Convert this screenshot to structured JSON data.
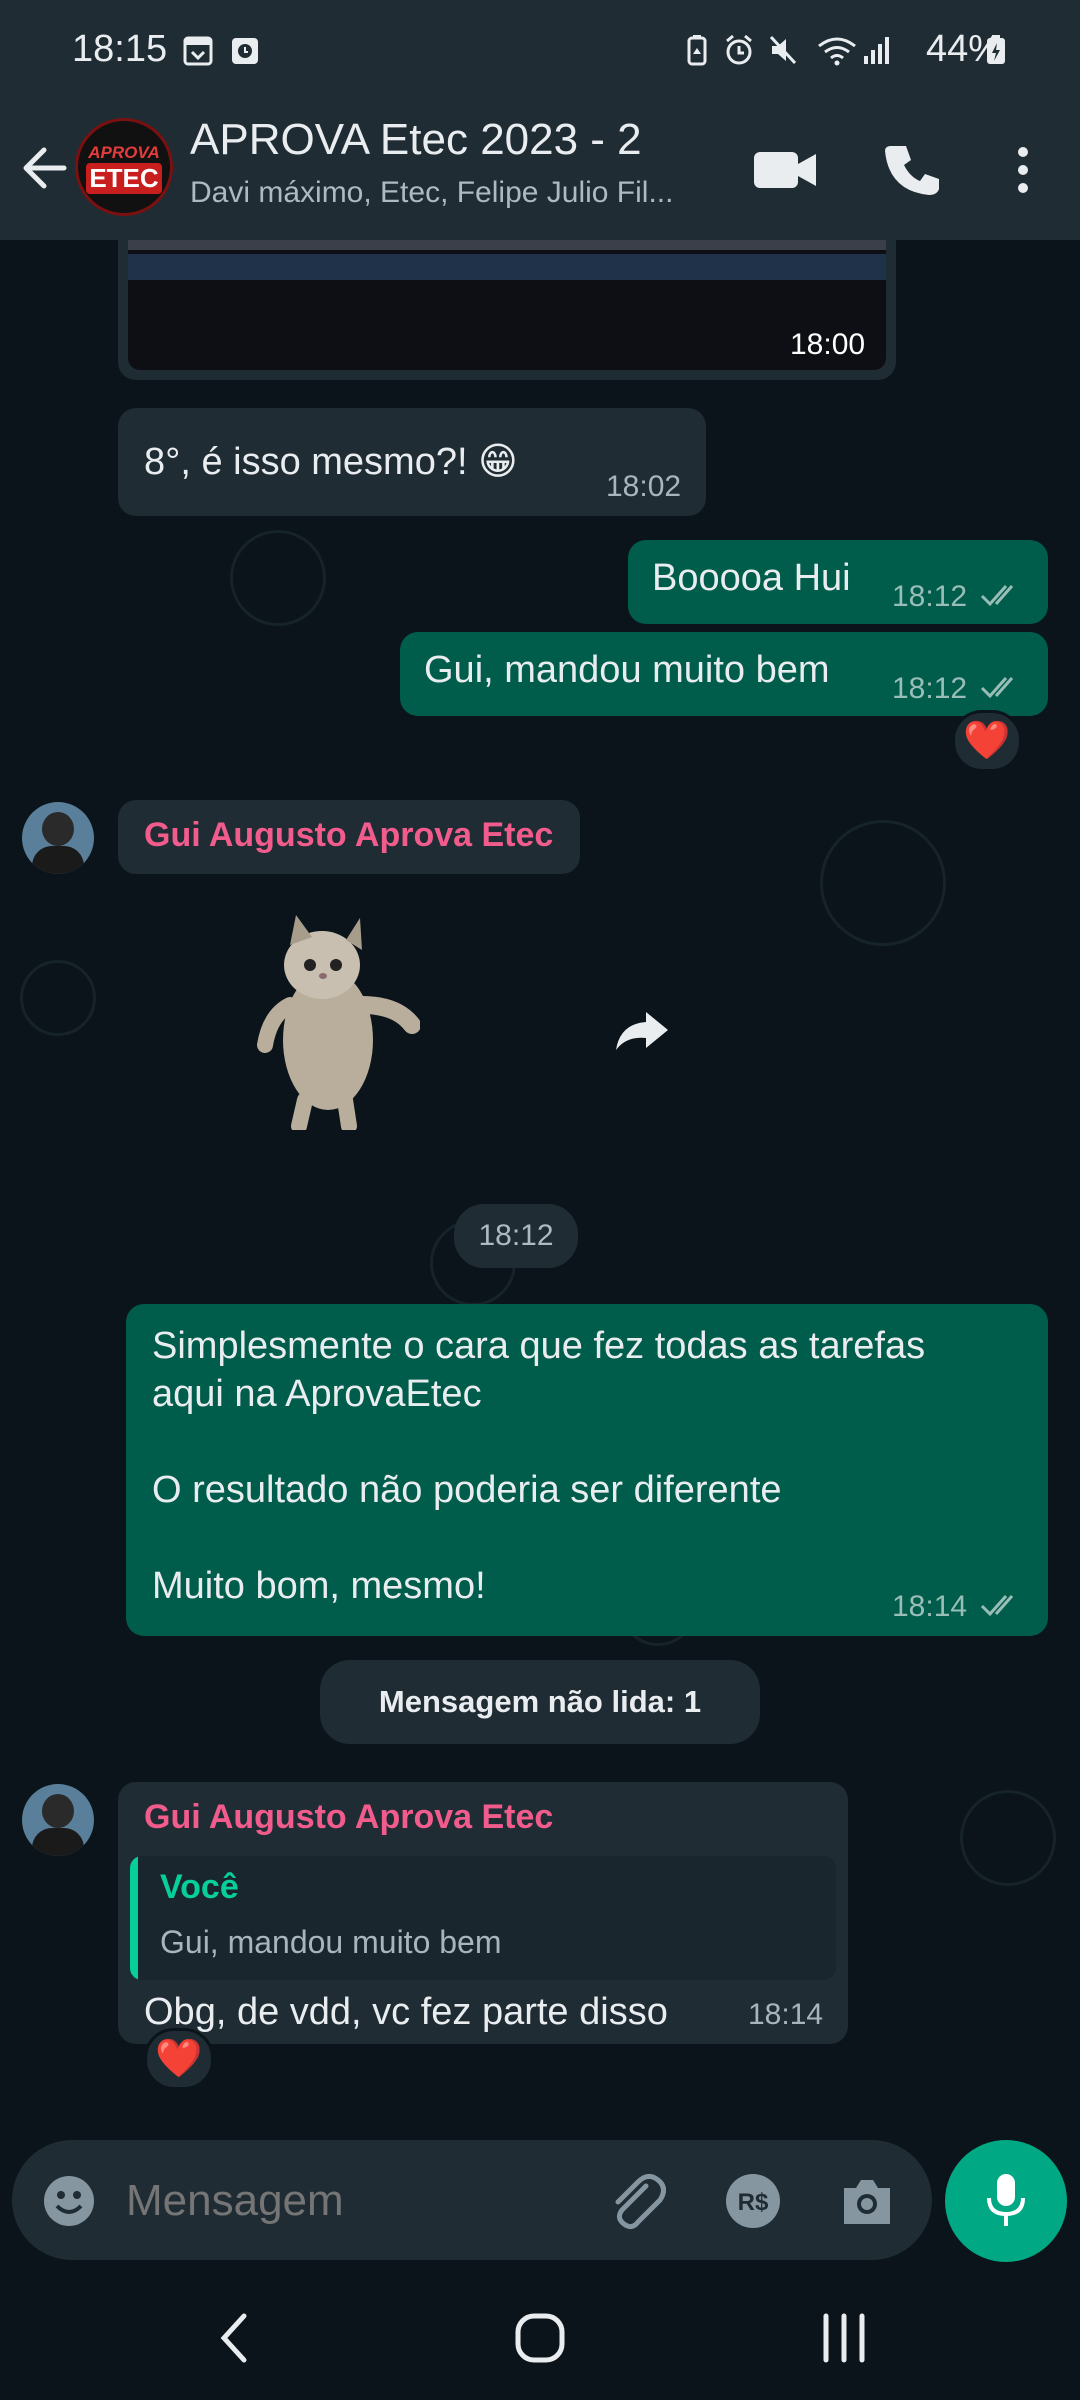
{
  "status": {
    "time": "18:15",
    "battery": "44%"
  },
  "header": {
    "title": "APROVA Etec 2023 - 2",
    "subtitle": "Davi máximo, Etec, Felipe Julio Fil...",
    "avatar_line1": "APROVA",
    "avatar_line2": "ETEC"
  },
  "messages": {
    "image_time": "18:00",
    "m1": {
      "text": "8°, é isso mesmo?! 😁",
      "time": "18:02"
    },
    "m2": {
      "text": "Booooa Hui",
      "time": "18:12"
    },
    "m3": {
      "text": "Gui, mandou muito bem",
      "time": "18:12",
      "reaction": "❤️"
    },
    "sticker": {
      "sender": "Gui Augusto Aprova Etec",
      "time": "18:12"
    },
    "m4": {
      "text": "Simplesmente o cara que fez todas as tarefas\naqui na AprovaEtec\n\nO resultado não poderia ser diferente\n\nMuito bom, mesmo!",
      "time": "18:14"
    },
    "unread_label": "Mensagem não lida: 1",
    "m5": {
      "sender": "Gui Augusto Aprova Etec",
      "quote_author": "Você",
      "quote_text": "Gui, mandou muito bem",
      "text": "Obg, de vdd, vc fez parte disso",
      "time": "18:14",
      "reaction": "❤️"
    }
  },
  "input": {
    "placeholder": "Mensagem"
  },
  "icons": [
    "back-arrow-icon",
    "video-call-icon",
    "phone-icon",
    "more-vert-icon",
    "share-icon",
    "emoji-icon",
    "attach-icon",
    "payment-icon",
    "camera-icon",
    "mic-icon"
  ],
  "colors": {
    "accent": "#00a884",
    "outgoing": "#005c4b",
    "incoming": "#1f2c34",
    "sender_name": "#f15c8d",
    "quote_author": "#06cf9c"
  }
}
